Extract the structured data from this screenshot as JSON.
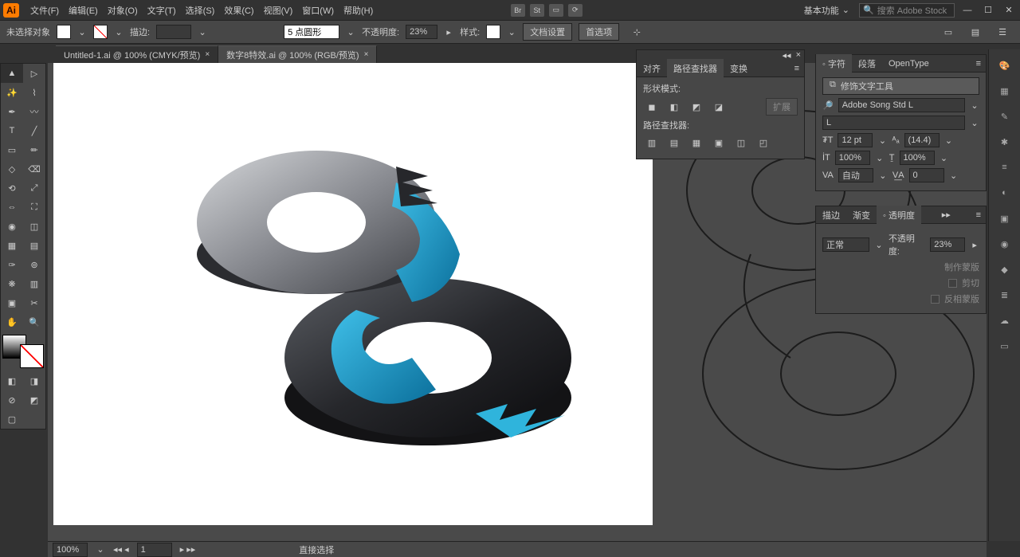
{
  "app_badge": "Ai",
  "menu": {
    "file": "文件(F)",
    "edit": "编辑(E)",
    "object": "对象(O)",
    "type": "文字(T)",
    "select": "选择(S)",
    "effect": "效果(C)",
    "view": "视图(V)",
    "window": "窗口(W)",
    "help": "帮助(H)"
  },
  "menubar_icons": {
    "br": "Br",
    "st": "St"
  },
  "workspace": "基本功能",
  "search_placeholder": "搜索 Adobe Stock",
  "control": {
    "selection_status": "未选择对象",
    "stroke_label": "描边:",
    "stroke_val": "",
    "dash_label": "5 点圆形",
    "opacity_label": "不透明度:",
    "opacity_val": "23%",
    "style_label": "样式:",
    "doc_setup": "文档设置",
    "prefs": "首选项"
  },
  "tabs": [
    {
      "label": "Untitled-1.ai @ 100% (CMYK/预览)",
      "active": false
    },
    {
      "label": "数字8特效.ai @ 100% (RGB/预览)",
      "active": true
    }
  ],
  "align_panel": {
    "tabs": {
      "align": "对齐",
      "pathfinder": "路径查找器",
      "transform": "变换"
    },
    "shape_modes": "形状模式:",
    "expand": "扩展",
    "pathfinders": "路径查找器:"
  },
  "char_panel": {
    "tabs": {
      "char": "字符",
      "para": "段落",
      "opentype": "OpenType"
    },
    "touch_type": "修饰文字工具",
    "font_family": "Adobe Song Std L",
    "font_style": "L",
    "size": "12 pt",
    "leading": "(14.4)",
    "hscale": "100%",
    "vscale": "100%",
    "kerning": "自动",
    "tracking": "0"
  },
  "trans_panel": {
    "tabs": {
      "stroke": "描边",
      "grad": "渐变",
      "trans": "透明度"
    },
    "blend": "正常",
    "opacity_label": "不透明度:",
    "opacity_val": "23%",
    "make_mask": "制作蒙版",
    "clip": "剪切",
    "invert": "反相蒙版"
  },
  "status": {
    "zoom": "100%",
    "artboard": "1",
    "tool": "直接选择"
  }
}
